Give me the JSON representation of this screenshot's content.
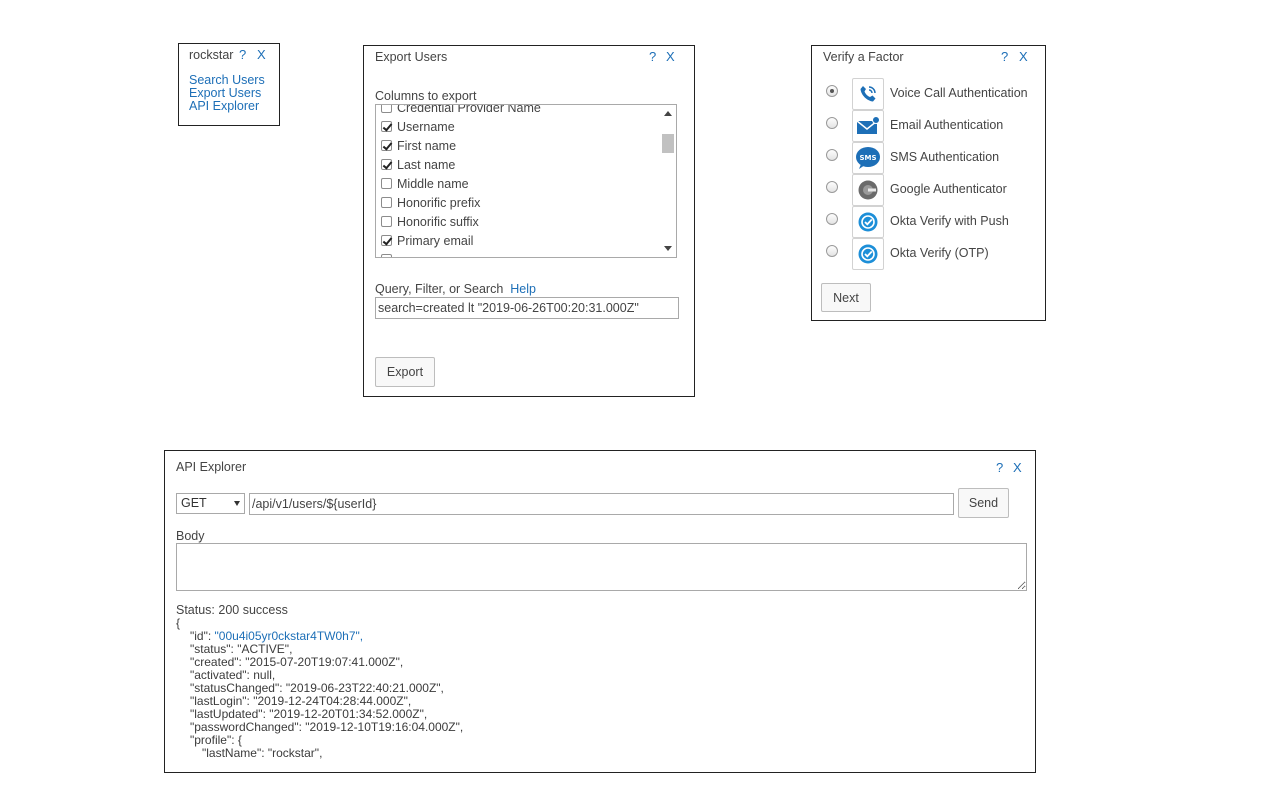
{
  "rockstar_panel": {
    "title": "rockstar",
    "help": "?",
    "close": "X",
    "links": [
      "Search Users",
      "Export Users",
      "API Explorer"
    ]
  },
  "export_panel": {
    "title": "Export Users",
    "help": "?",
    "close": "X",
    "columns_label": "Columns to export",
    "columns": [
      {
        "label": "Credential Provider Name",
        "checked": false
      },
      {
        "label": "Username",
        "checked": true
      },
      {
        "label": "First name",
        "checked": true
      },
      {
        "label": "Last name",
        "checked": true
      },
      {
        "label": "Middle name",
        "checked": false
      },
      {
        "label": "Honorific prefix",
        "checked": false
      },
      {
        "label": "Honorific suffix",
        "checked": false
      },
      {
        "label": "Primary email",
        "checked": true
      }
    ],
    "query_label": "Query, Filter, or Search",
    "help_link": "Help",
    "query_value": "search=created lt \"2019-06-26T00:20:31.000Z\"",
    "export_button": "Export"
  },
  "verify_panel": {
    "title": "Verify a Factor",
    "help": "?",
    "close": "X",
    "factors": [
      {
        "label": "Voice Call Authentication",
        "icon": "phone-call-icon",
        "selected": true
      },
      {
        "label": "Email Authentication",
        "icon": "email-icon",
        "selected": false
      },
      {
        "label": "SMS Authentication",
        "icon": "sms-icon",
        "selected": false
      },
      {
        "label": "Google Authenticator",
        "icon": "google-authenticator-icon",
        "selected": false
      },
      {
        "label": "Okta Verify with Push",
        "icon": "okta-verify-icon",
        "selected": false
      },
      {
        "label": "Okta Verify (OTP)",
        "icon": "okta-verify-icon",
        "selected": false
      }
    ],
    "next_button": "Next"
  },
  "api_explorer": {
    "title": "API Explorer",
    "help": "?",
    "close": "X",
    "method": "GET",
    "url": "/api/v1/users/${userId}",
    "send_button": "Send",
    "body_label": "Body",
    "status": "Status: 200 success",
    "json_open": "{",
    "json_lines": [
      {
        "key": "\"id\": ",
        "value": "\"00u4i05yr0ckstar4TW0h7\",",
        "link": true
      },
      {
        "key": "\"status\": ",
        "value": "\"ACTIVE\",",
        "link": false
      },
      {
        "key": "\"created\": ",
        "value": "\"2015-07-20T19:07:41.000Z\",",
        "link": false
      },
      {
        "key": "\"activated\": ",
        "value": "null,",
        "link": false
      },
      {
        "key": "\"statusChanged\": ",
        "value": "\"2019-06-23T22:40:21.000Z\",",
        "link": false
      },
      {
        "key": "\"lastLogin\": ",
        "value": "\"2019-12-24T04:28:44.000Z\",",
        "link": false
      },
      {
        "key": "\"lastUpdated\": ",
        "value": "\"2019-12-20T01:34:52.000Z\",",
        "link": false
      },
      {
        "key": "\"passwordChanged\": ",
        "value": "\"2019-12-10T19:16:04.000Z\",",
        "link": false
      },
      {
        "key": "\"profile\": ",
        "value": "{",
        "link": false
      }
    ],
    "json_nested": "\"lastName\": \"rockstar\","
  },
  "colors": {
    "link": "#1d6fb7",
    "text": "#3b3b3b",
    "border": "#222222"
  }
}
